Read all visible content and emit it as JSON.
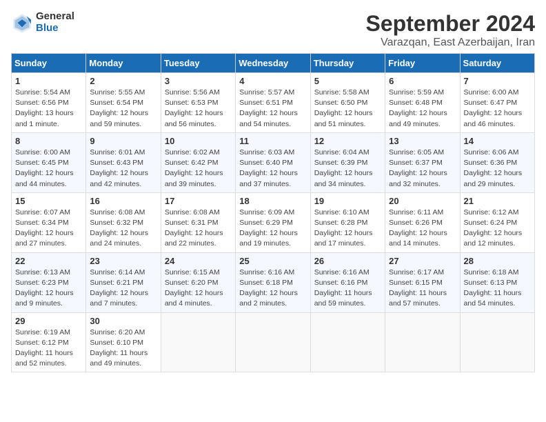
{
  "header": {
    "logo_general": "General",
    "logo_blue": "Blue",
    "title": "September 2024",
    "subtitle": "Varazqan, East Azerbaijan, Iran"
  },
  "calendar": {
    "days_of_week": [
      "Sunday",
      "Monday",
      "Tuesday",
      "Wednesday",
      "Thursday",
      "Friday",
      "Saturday"
    ],
    "weeks": [
      [
        {
          "day": "1",
          "detail": "Sunrise: 5:54 AM\nSunset: 6:56 PM\nDaylight: 13 hours\nand 1 minute."
        },
        {
          "day": "2",
          "detail": "Sunrise: 5:55 AM\nSunset: 6:54 PM\nDaylight: 12 hours\nand 59 minutes."
        },
        {
          "day": "3",
          "detail": "Sunrise: 5:56 AM\nSunset: 6:53 PM\nDaylight: 12 hours\nand 56 minutes."
        },
        {
          "day": "4",
          "detail": "Sunrise: 5:57 AM\nSunset: 6:51 PM\nDaylight: 12 hours\nand 54 minutes."
        },
        {
          "day": "5",
          "detail": "Sunrise: 5:58 AM\nSunset: 6:50 PM\nDaylight: 12 hours\nand 51 minutes."
        },
        {
          "day": "6",
          "detail": "Sunrise: 5:59 AM\nSunset: 6:48 PM\nDaylight: 12 hours\nand 49 minutes."
        },
        {
          "day": "7",
          "detail": "Sunrise: 6:00 AM\nSunset: 6:47 PM\nDaylight: 12 hours\nand 46 minutes."
        }
      ],
      [
        {
          "day": "8",
          "detail": "Sunrise: 6:00 AM\nSunset: 6:45 PM\nDaylight: 12 hours\nand 44 minutes."
        },
        {
          "day": "9",
          "detail": "Sunrise: 6:01 AM\nSunset: 6:43 PM\nDaylight: 12 hours\nand 42 minutes."
        },
        {
          "day": "10",
          "detail": "Sunrise: 6:02 AM\nSunset: 6:42 PM\nDaylight: 12 hours\nand 39 minutes."
        },
        {
          "day": "11",
          "detail": "Sunrise: 6:03 AM\nSunset: 6:40 PM\nDaylight: 12 hours\nand 37 minutes."
        },
        {
          "day": "12",
          "detail": "Sunrise: 6:04 AM\nSunset: 6:39 PM\nDaylight: 12 hours\nand 34 minutes."
        },
        {
          "day": "13",
          "detail": "Sunrise: 6:05 AM\nSunset: 6:37 PM\nDaylight: 12 hours\nand 32 minutes."
        },
        {
          "day": "14",
          "detail": "Sunrise: 6:06 AM\nSunset: 6:36 PM\nDaylight: 12 hours\nand 29 minutes."
        }
      ],
      [
        {
          "day": "15",
          "detail": "Sunrise: 6:07 AM\nSunset: 6:34 PM\nDaylight: 12 hours\nand 27 minutes."
        },
        {
          "day": "16",
          "detail": "Sunrise: 6:08 AM\nSunset: 6:32 PM\nDaylight: 12 hours\nand 24 minutes."
        },
        {
          "day": "17",
          "detail": "Sunrise: 6:08 AM\nSunset: 6:31 PM\nDaylight: 12 hours\nand 22 minutes."
        },
        {
          "day": "18",
          "detail": "Sunrise: 6:09 AM\nSunset: 6:29 PM\nDaylight: 12 hours\nand 19 minutes."
        },
        {
          "day": "19",
          "detail": "Sunrise: 6:10 AM\nSunset: 6:28 PM\nDaylight: 12 hours\nand 17 minutes."
        },
        {
          "day": "20",
          "detail": "Sunrise: 6:11 AM\nSunset: 6:26 PM\nDaylight: 12 hours\nand 14 minutes."
        },
        {
          "day": "21",
          "detail": "Sunrise: 6:12 AM\nSunset: 6:24 PM\nDaylight: 12 hours\nand 12 minutes."
        }
      ],
      [
        {
          "day": "22",
          "detail": "Sunrise: 6:13 AM\nSunset: 6:23 PM\nDaylight: 12 hours\nand 9 minutes."
        },
        {
          "day": "23",
          "detail": "Sunrise: 6:14 AM\nSunset: 6:21 PM\nDaylight: 12 hours\nand 7 minutes."
        },
        {
          "day": "24",
          "detail": "Sunrise: 6:15 AM\nSunset: 6:20 PM\nDaylight: 12 hours\nand 4 minutes."
        },
        {
          "day": "25",
          "detail": "Sunrise: 6:16 AM\nSunset: 6:18 PM\nDaylight: 12 hours\nand 2 minutes."
        },
        {
          "day": "26",
          "detail": "Sunrise: 6:16 AM\nSunset: 6:16 PM\nDaylight: 11 hours\nand 59 minutes."
        },
        {
          "day": "27",
          "detail": "Sunrise: 6:17 AM\nSunset: 6:15 PM\nDaylight: 11 hours\nand 57 minutes."
        },
        {
          "day": "28",
          "detail": "Sunrise: 6:18 AM\nSunset: 6:13 PM\nDaylight: 11 hours\nand 54 minutes."
        }
      ],
      [
        {
          "day": "29",
          "detail": "Sunrise: 6:19 AM\nSunset: 6:12 PM\nDaylight: 11 hours\nand 52 minutes."
        },
        {
          "day": "30",
          "detail": "Sunrise: 6:20 AM\nSunset: 6:10 PM\nDaylight: 11 hours\nand 49 minutes."
        },
        {
          "day": "",
          "detail": ""
        },
        {
          "day": "",
          "detail": ""
        },
        {
          "day": "",
          "detail": ""
        },
        {
          "day": "",
          "detail": ""
        },
        {
          "day": "",
          "detail": ""
        }
      ]
    ]
  }
}
